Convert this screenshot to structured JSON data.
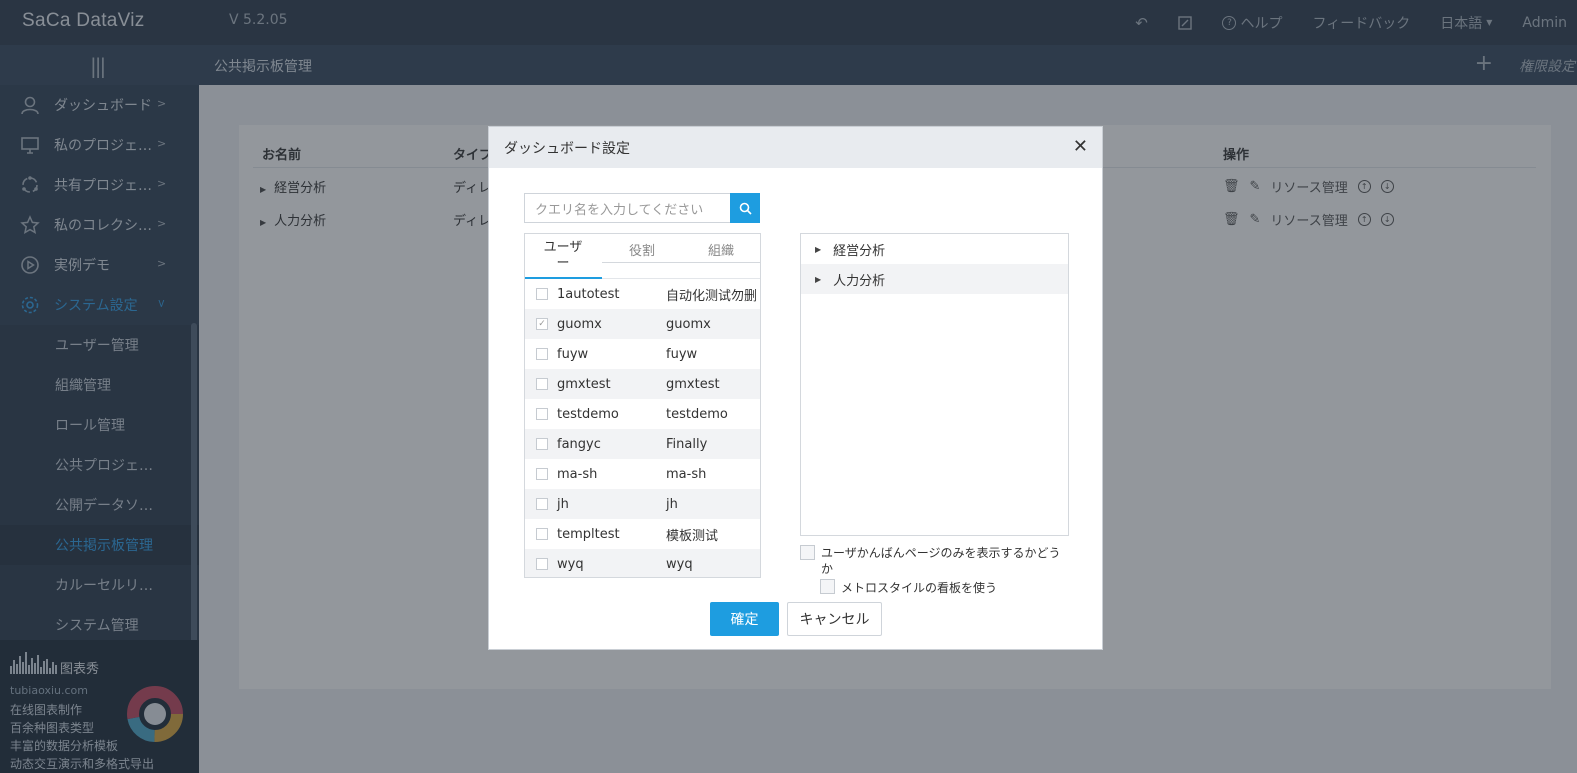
{
  "app": {
    "logo": "SaCa DataViz",
    "version": "V 5.2.05",
    "help_label": "ヘルプ",
    "feedback_label": "フィードバック",
    "language_label": "日本語",
    "user_label": "Admin"
  },
  "subbar": {
    "breadcrumb": "公共掲示板管理",
    "permission_label": "権限設定"
  },
  "sidebar": {
    "items": [
      {
        "label": "ダッシュボード",
        "icon": "user-icon"
      },
      {
        "label": "私のプロジェ…",
        "icon": "monitor-icon"
      },
      {
        "label": "共有プロジェ…",
        "icon": "share-icon"
      },
      {
        "label": "私のコレクシ…",
        "icon": "star-icon"
      },
      {
        "label": "実例デモ",
        "icon": "play-icon"
      },
      {
        "label": "システム設定",
        "icon": "gear-icon"
      }
    ],
    "sub_items": [
      "ユーザー管理",
      "組織管理",
      "ロール管理",
      "公共プロジェ…",
      "公開データソ…",
      "公共掲示板管理",
      "カルーセルリ…",
      "システム管理"
    ],
    "selected_sub": "公共掲示板管理",
    "ad": {
      "brand": "图表秀",
      "site": "tubiaoxiu.com",
      "lines": [
        "在线图表制作",
        "百余种图表类型",
        "丰富的数据分析模板",
        "动态交互演示和多格式导出"
      ]
    }
  },
  "table": {
    "headers": {
      "name": "お名前",
      "type": "タイプ",
      "ops": "操作"
    },
    "rows": [
      {
        "name": "経営分析",
        "type": "ディレ"
      },
      {
        "name": "人力分析",
        "type": "ディレ"
      }
    ],
    "resource_label": "リソース管理"
  },
  "modal": {
    "title": "ダッシュボード設定",
    "search_placeholder": "クエリ名を入力してください",
    "tabs": [
      "ユーザー",
      "役割",
      "組織"
    ],
    "users": [
      {
        "id": "1autotest",
        "name": "自动化测试勿删",
        "checked": false
      },
      {
        "id": "guomx",
        "name": "guomx",
        "checked": true
      },
      {
        "id": "fuyw",
        "name": "fuyw",
        "checked": false
      },
      {
        "id": "gmxtest",
        "name": "gmxtest",
        "checked": false
      },
      {
        "id": "testdemo",
        "name": "testdemo",
        "checked": false
      },
      {
        "id": "fangyc",
        "name": "Finally",
        "checked": false
      },
      {
        "id": "ma-sh",
        "name": "ma-sh",
        "checked": false
      },
      {
        "id": "jh",
        "name": "jh",
        "checked": false
      },
      {
        "id": "templtest",
        "name": "模板测试",
        "checked": false
      },
      {
        "id": "wyq",
        "name": "wyq",
        "checked": false
      }
    ],
    "tree": [
      "経営分析",
      "人力分析"
    ],
    "option_user_only": "ユーザかんばんページのみを表示するかどうか",
    "option_metro": "メトロスタイルの看板を使う",
    "ok_label": "確定",
    "cancel_label": "キャンセル"
  },
  "colors": {
    "accent": "#1e9de0",
    "topbar": "#2c3b4d",
    "sidebar": "#2f4155"
  }
}
